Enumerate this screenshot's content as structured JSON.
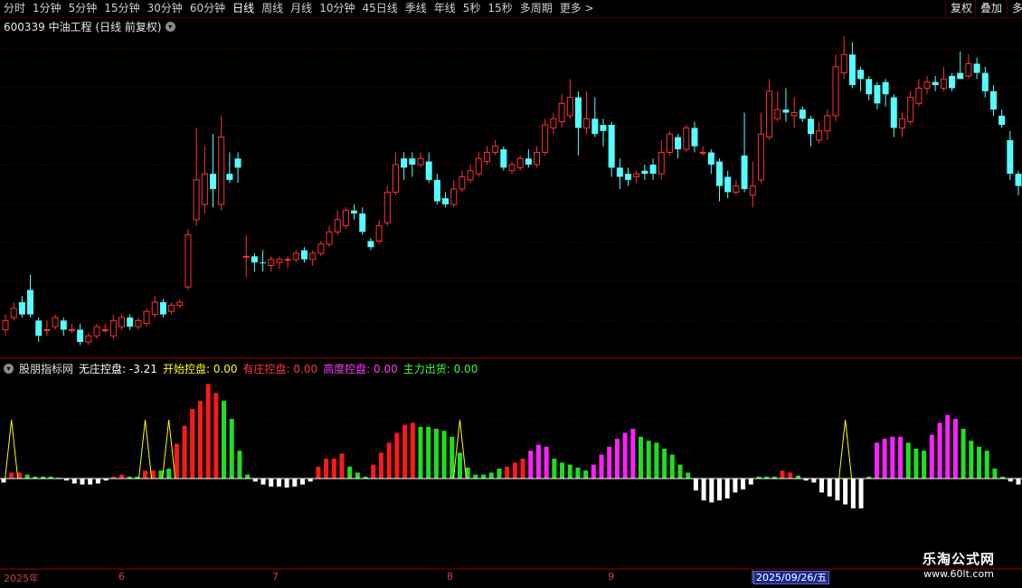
{
  "toolbar": {
    "tabs": [
      "分时",
      "1分钟",
      "5分钟",
      "15分钟",
      "30分钟",
      "60分钟",
      "日线",
      "周线",
      "月线",
      "10分钟",
      "45日线",
      "季线",
      "年线",
      "5秒",
      "15秒",
      "多周期",
      "更多 >"
    ],
    "active_tab": "日线",
    "right_buttons": [
      "复权",
      "叠加",
      "多"
    ]
  },
  "chart_title": {
    "text": "600339 中油工程 (日线 前复权)"
  },
  "indicator": {
    "name": "股朋指标网",
    "items": [
      {
        "label": "无庄控盘:",
        "value": "-3.21",
        "color": "#ffffff"
      },
      {
        "label": "开始控盘:",
        "value": "0.00",
        "color": "#ffff00"
      },
      {
        "label": "有庄控盘:",
        "value": "0.00",
        "color": "#ff3a3a"
      },
      {
        "label": "高度控盘:",
        "value": "0.00",
        "color": "#ff3aff"
      },
      {
        "label": "主力出货:",
        "value": "0.00",
        "color": "#3aff3a"
      }
    ]
  },
  "time_axis": {
    "labels": [
      "2025年",
      "6",
      "7",
      "8",
      "9"
    ],
    "selected_date": "2025/09/26/五"
  },
  "watermark": {
    "line1": "乐淘公式网",
    "line2": "www.60lt.com"
  },
  "colors": {
    "up": "#ff3232",
    "down": "#54ffff",
    "background": "#000000"
  },
  "chart_data": {
    "type": "candlestick",
    "candles": [
      [
        1,
        0.04,
        0.07,
        0.02,
        0.09
      ],
      [
        1,
        0.08,
        0.11,
        0.07,
        0.13
      ],
      [
        0,
        0.13,
        0.09,
        0.08,
        0.15
      ],
      [
        0,
        0.17,
        0.09,
        0.08,
        0.22
      ],
      [
        0,
        0.07,
        0.02,
        0.0,
        0.08
      ],
      [
        1,
        0.04,
        0.04,
        0.02,
        0.07
      ],
      [
        1,
        0.05,
        0.08,
        0.04,
        0.09
      ],
      [
        0,
        0.07,
        0.04,
        0.02,
        0.08
      ],
      [
        1,
        0.04,
        0.04,
        0.03,
        0.06
      ],
      [
        0,
        0.04,
        0.0,
        -0.01,
        0.06
      ],
      [
        1,
        0.0,
        0.02,
        -0.01,
        0.03
      ],
      [
        1,
        0.02,
        0.05,
        0.01,
        0.06
      ],
      [
        1,
        0.04,
        0.04,
        0.03,
        0.06
      ],
      [
        1,
        0.02,
        0.07,
        0.01,
        0.09
      ],
      [
        1,
        0.05,
        0.08,
        0.04,
        0.09
      ],
      [
        0,
        0.08,
        0.05,
        0.04,
        0.09
      ],
      [
        1,
        0.05,
        0.07,
        0.04,
        0.08
      ],
      [
        1,
        0.06,
        0.1,
        0.05,
        0.11
      ],
      [
        1,
        0.09,
        0.13,
        0.08,
        0.15
      ],
      [
        0,
        0.13,
        0.09,
        0.08,
        0.14
      ],
      [
        1,
        0.1,
        0.12,
        0.09,
        0.13
      ],
      [
        1,
        0.12,
        0.13,
        0.11,
        0.14
      ],
      [
        1,
        0.18,
        0.35,
        0.17,
        0.37
      ],
      [
        1,
        0.4,
        0.53,
        0.38,
        0.7
      ],
      [
        1,
        0.45,
        0.55,
        0.42,
        0.64
      ],
      [
        0,
        0.55,
        0.5,
        0.44,
        0.68
      ],
      [
        1,
        0.45,
        0.67,
        0.43,
        0.74
      ],
      [
        0,
        0.55,
        0.53,
        0.52,
        0.62
      ],
      [
        0,
        0.6,
        0.57,
        0.52,
        0.62
      ],
      [
        1,
        0.28,
        0.28,
        0.21,
        0.35
      ],
      [
        0,
        0.28,
        0.26,
        0.23,
        0.29
      ],
      [
        0,
        0.26,
        0.26,
        0.23,
        0.3
      ],
      [
        1,
        0.25,
        0.27,
        0.23,
        0.28
      ],
      [
        1,
        0.26,
        0.27,
        0.24,
        0.28
      ],
      [
        1,
        0.27,
        0.27,
        0.24,
        0.28
      ],
      [
        1,
        0.27,
        0.29,
        0.26,
        0.3
      ],
      [
        0,
        0.3,
        0.27,
        0.26,
        0.31
      ],
      [
        1,
        0.27,
        0.29,
        0.25,
        0.3
      ],
      [
        1,
        0.29,
        0.32,
        0.28,
        0.33
      ],
      [
        1,
        0.32,
        0.36,
        0.31,
        0.38
      ],
      [
        1,
        0.36,
        0.4,
        0.35,
        0.43
      ],
      [
        1,
        0.38,
        0.43,
        0.37,
        0.44
      ],
      [
        0,
        0.43,
        0.42,
        0.4,
        0.45
      ],
      [
        0,
        0.42,
        0.36,
        0.35,
        0.44
      ],
      [
        0,
        0.33,
        0.31,
        0.3,
        0.34
      ],
      [
        1,
        0.33,
        0.38,
        0.32,
        0.4
      ],
      [
        1,
        0.39,
        0.49,
        0.38,
        0.51
      ],
      [
        1,
        0.49,
        0.58,
        0.48,
        0.62
      ],
      [
        0,
        0.6,
        0.57,
        0.53,
        0.62
      ],
      [
        0,
        0.6,
        0.58,
        0.54,
        0.62
      ],
      [
        1,
        0.58,
        0.6,
        0.57,
        0.62
      ],
      [
        0,
        0.59,
        0.53,
        0.52,
        0.62
      ],
      [
        0,
        0.53,
        0.46,
        0.45,
        0.55
      ],
      [
        0,
        0.47,
        0.45,
        0.44,
        0.49
      ],
      [
        1,
        0.45,
        0.5,
        0.44,
        0.53
      ],
      [
        1,
        0.5,
        0.54,
        0.49,
        0.56
      ],
      [
        1,
        0.53,
        0.56,
        0.52,
        0.58
      ],
      [
        1,
        0.55,
        0.6,
        0.54,
        0.62
      ],
      [
        1,
        0.59,
        0.62,
        0.58,
        0.64
      ],
      [
        1,
        0.62,
        0.64,
        0.61,
        0.66
      ],
      [
        0,
        0.63,
        0.57,
        0.56,
        0.64
      ],
      [
        1,
        0.56,
        0.58,
        0.55,
        0.59
      ],
      [
        1,
        0.57,
        0.6,
        0.56,
        0.61
      ],
      [
        0,
        0.6,
        0.58,
        0.57,
        0.63
      ],
      [
        1,
        0.58,
        0.62,
        0.57,
        0.64
      ],
      [
        1,
        0.62,
        0.71,
        0.61,
        0.73
      ],
      [
        1,
        0.7,
        0.73,
        0.68,
        0.75
      ],
      [
        1,
        0.72,
        0.78,
        0.7,
        0.81
      ],
      [
        1,
        0.74,
        0.8,
        0.73,
        0.86
      ],
      [
        0,
        0.8,
        0.7,
        0.61,
        0.82
      ],
      [
        1,
        0.7,
        0.73,
        0.68,
        0.82
      ],
      [
        0,
        0.73,
        0.68,
        0.67,
        0.8
      ],
      [
        0,
        0.71,
        0.69,
        0.64,
        0.73
      ],
      [
        0,
        0.71,
        0.57,
        0.54,
        0.72
      ],
      [
        0,
        0.57,
        0.54,
        0.5,
        0.6
      ],
      [
        0,
        0.55,
        0.53,
        0.51,
        0.57
      ],
      [
        1,
        0.54,
        0.55,
        0.52,
        0.56
      ],
      [
        0,
        0.56,
        0.55,
        0.53,
        0.58
      ],
      [
        0,
        0.58,
        0.55,
        0.53,
        0.6
      ],
      [
        1,
        0.55,
        0.62,
        0.53,
        0.66
      ],
      [
        1,
        0.62,
        0.68,
        0.61,
        0.69
      ],
      [
        0,
        0.67,
        0.63,
        0.6,
        0.68
      ],
      [
        1,
        0.63,
        0.7,
        0.62,
        0.71
      ],
      [
        0,
        0.7,
        0.64,
        0.62,
        0.72
      ],
      [
        1,
        0.62,
        0.62,
        0.61,
        0.64
      ],
      [
        0,
        0.62,
        0.58,
        0.55,
        0.63
      ],
      [
        0,
        0.59,
        0.51,
        0.46,
        0.6
      ],
      [
        0,
        0.54,
        0.49,
        0.47,
        0.56
      ],
      [
        1,
        0.49,
        0.51,
        0.48,
        0.53
      ],
      [
        0,
        0.61,
        0.5,
        0.49,
        0.75
      ],
      [
        1,
        0.48,
        0.51,
        0.44,
        0.59
      ],
      [
        1,
        0.53,
        0.68,
        0.52,
        0.75
      ],
      [
        1,
        0.67,
        0.82,
        0.66,
        0.86
      ],
      [
        1,
        0.73,
        0.76,
        0.72,
        0.82
      ],
      [
        0,
        0.76,
        0.75,
        0.72,
        0.83
      ],
      [
        1,
        0.74,
        0.75,
        0.7,
        0.8
      ],
      [
        0,
        0.76,
        0.73,
        0.72,
        0.77
      ],
      [
        0,
        0.73,
        0.68,
        0.64,
        0.74
      ],
      [
        1,
        0.66,
        0.69,
        0.65,
        0.72
      ],
      [
        1,
        0.69,
        0.74,
        0.66,
        0.76
      ],
      [
        1,
        0.74,
        0.9,
        0.72,
        0.94
      ],
      [
        1,
        0.88,
        0.94,
        0.86,
        1.0
      ],
      [
        0,
        0.94,
        0.84,
        0.83,
        0.98
      ],
      [
        0,
        0.89,
        0.86,
        0.82,
        0.9
      ],
      [
        0,
        0.86,
        0.81,
        0.79,
        0.87
      ],
      [
        0,
        0.84,
        0.78,
        0.76,
        0.85
      ],
      [
        0,
        0.85,
        0.81,
        0.77,
        0.86
      ],
      [
        0,
        0.8,
        0.7,
        0.67,
        0.81
      ],
      [
        1,
        0.7,
        0.73,
        0.67,
        0.75
      ],
      [
        1,
        0.72,
        0.8,
        0.71,
        0.82
      ],
      [
        1,
        0.78,
        0.83,
        0.77,
        0.86
      ],
      [
        1,
        0.83,
        0.85,
        0.81,
        0.87
      ],
      [
        0,
        0.85,
        0.84,
        0.82,
        0.87
      ],
      [
        1,
        0.83,
        0.86,
        0.82,
        0.9
      ],
      [
        0,
        0.87,
        0.83,
        0.82,
        0.88
      ],
      [
        0,
        0.86,
        0.88,
        0.86,
        0.95
      ],
      [
        1,
        0.87,
        0.91,
        0.86,
        0.94
      ],
      [
        0,
        0.91,
        0.88,
        0.86,
        0.93
      ],
      [
        0,
        0.88,
        0.82,
        0.8,
        0.9
      ],
      [
        0,
        0.82,
        0.76,
        0.74,
        0.84
      ],
      [
        0,
        0.74,
        0.71,
        0.7,
        0.76
      ],
      [
        0,
        0.66,
        0.55,
        0.53,
        0.69
      ],
      [
        0,
        0.55,
        0.51,
        0.48,
        0.56
      ]
    ],
    "indicator_bars": [
      [
        "w",
        -0.04
      ],
      [
        "r",
        0.06
      ],
      [
        "r",
        0.06
      ],
      [
        "g",
        0.04
      ],
      [
        "g",
        0.02
      ],
      [
        "g",
        0.02
      ],
      [
        "g",
        0.02
      ],
      [
        "g",
        0.01
      ],
      [
        "w",
        -0.02
      ],
      [
        "w",
        -0.05
      ],
      [
        "w",
        -0.06
      ],
      [
        "w",
        -0.06
      ],
      [
        "w",
        -0.05
      ],
      [
        "w",
        -0.02
      ],
      [
        "r",
        0.02
      ],
      [
        "r",
        0.04
      ],
      [
        "g",
        0.02
      ],
      [
        "g",
        0.02
      ],
      [
        "r",
        0.08
      ],
      [
        "r",
        0.08
      ],
      [
        "g",
        0.08
      ],
      [
        "g",
        0.1
      ],
      [
        "r",
        0.35
      ],
      [
        "r",
        0.53
      ],
      [
        "r",
        0.7
      ],
      [
        "r",
        0.78
      ],
      [
        "r",
        0.95
      ],
      [
        "r",
        0.86
      ],
      [
        "g",
        0.78
      ],
      [
        "g",
        0.6
      ],
      [
        "g",
        0.28
      ],
      [
        "g",
        0.04
      ],
      [
        "w",
        -0.03
      ],
      [
        "w",
        -0.06
      ],
      [
        "w",
        -0.08
      ],
      [
        "w",
        -0.08
      ],
      [
        "w",
        -0.09
      ],
      [
        "w",
        -0.08
      ],
      [
        "w",
        -0.06
      ],
      [
        "w",
        -0.03
      ],
      [
        "r",
        0.12
      ],
      [
        "r",
        0.2
      ],
      [
        "r",
        0.2
      ],
      [
        "r",
        0.25
      ],
      [
        "g",
        0.12
      ],
      [
        "g",
        0.06
      ],
      [
        "g",
        0.02
      ],
      [
        "r",
        0.14
      ],
      [
        "r",
        0.26
      ],
      [
        "r",
        0.36
      ],
      [
        "r",
        0.46
      ],
      [
        "r",
        0.54
      ],
      [
        "r",
        0.56
      ],
      [
        "g",
        0.52
      ],
      [
        "g",
        0.52
      ],
      [
        "g",
        0.5
      ],
      [
        "g",
        0.48
      ],
      [
        "g",
        0.42
      ],
      [
        "g",
        0.26
      ],
      [
        "g",
        0.11
      ],
      [
        "g",
        0.04
      ],
      [
        "g",
        0.04
      ],
      [
        "g",
        0.06
      ],
      [
        "g",
        0.1
      ],
      [
        "r",
        0.12
      ],
      [
        "r",
        0.16
      ],
      [
        "r",
        0.2
      ],
      [
        "m",
        0.28
      ],
      [
        "m",
        0.34
      ],
      [
        "m",
        0.32
      ],
      [
        "g",
        0.2
      ],
      [
        "g",
        0.16
      ],
      [
        "g",
        0.14
      ],
      [
        "g",
        0.11
      ],
      [
        "g",
        0.08
      ],
      [
        "m",
        0.14
      ],
      [
        "m",
        0.24
      ],
      [
        "m",
        0.32
      ],
      [
        "m",
        0.4
      ],
      [
        "m",
        0.46
      ],
      [
        "m",
        0.5
      ],
      [
        "g",
        0.42
      ],
      [
        "g",
        0.38
      ],
      [
        "g",
        0.36
      ],
      [
        "g",
        0.3
      ],
      [
        "g",
        0.24
      ],
      [
        "g",
        0.14
      ],
      [
        "g",
        0.06
      ],
      [
        "w",
        -0.12
      ],
      [
        "w",
        -0.22
      ],
      [
        "w",
        -0.24
      ],
      [
        "w",
        -0.22
      ],
      [
        "w",
        -0.2
      ],
      [
        "w",
        -0.14
      ],
      [
        "w",
        -0.11
      ],
      [
        "w",
        -0.06
      ],
      [
        "g",
        0.02
      ],
      [
        "g",
        0.02
      ],
      [
        "g",
        0.02
      ],
      [
        "r",
        0.08
      ],
      [
        "r",
        0.06
      ],
      [
        "g",
        0.03
      ],
      [
        "w",
        -0.02
      ],
      [
        "w",
        -0.04
      ],
      [
        "w",
        -0.14
      ],
      [
        "w",
        -0.18
      ],
      [
        "w",
        -0.22
      ],
      [
        "w",
        -0.26
      ],
      [
        "w",
        -0.3
      ],
      [
        "w",
        -0.3
      ],
      [
        "g",
        0.02
      ],
      [
        "m",
        0.36
      ],
      [
        "m",
        0.4
      ],
      [
        "m",
        0.42
      ],
      [
        "m",
        0.42
      ],
      [
        "g",
        0.36
      ],
      [
        "g",
        0.3
      ],
      [
        "g",
        0.28
      ],
      [
        "m",
        0.44
      ],
      [
        "m",
        0.56
      ],
      [
        "m",
        0.64
      ],
      [
        "m",
        0.6
      ],
      [
        "g",
        0.5
      ],
      [
        "g",
        0.38
      ],
      [
        "g",
        0.32
      ],
      [
        "g",
        0.28
      ],
      [
        "g",
        0.1
      ],
      [
        "g",
        0.02
      ],
      [
        "w",
        -0.03
      ],
      [
        "w",
        -0.06
      ]
    ],
    "signal_peaks": [
      1,
      18,
      21,
      58,
      107,
      144,
      170
    ],
    "time_axis_labels": [
      "2025年",
      "6",
      "7",
      "8",
      "9"
    ]
  }
}
